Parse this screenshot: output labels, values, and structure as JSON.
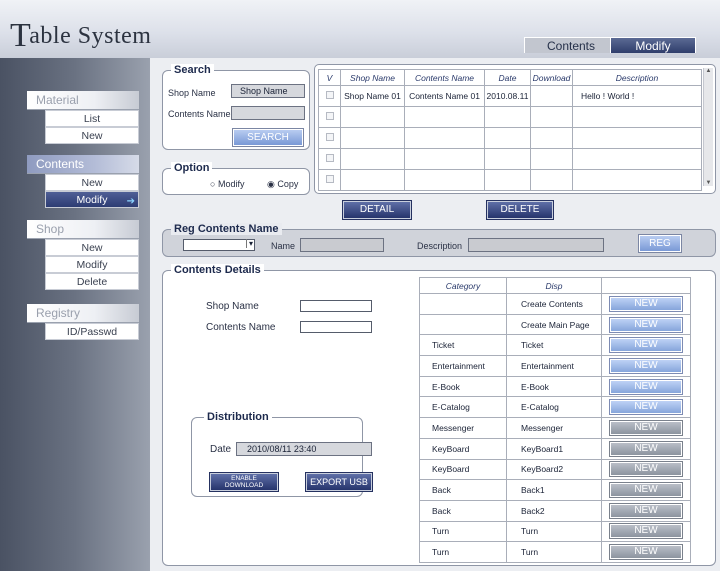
{
  "app": {
    "title_cap": "T",
    "title_rest": "able System"
  },
  "top_tabs": [
    {
      "label": "Contents",
      "active": false
    },
    {
      "label": "Modify",
      "active": true
    }
  ],
  "sidebar": {
    "groups": [
      {
        "title": "Material",
        "items": [
          "List",
          "New"
        ]
      },
      {
        "title": "Contents",
        "items": [
          "New",
          "Modify"
        ]
      },
      {
        "title": "Shop",
        "items": [
          "New",
          "Modify",
          "Delete"
        ]
      },
      {
        "title": "Registry",
        "items": [
          "ID/Passwd"
        ]
      }
    ]
  },
  "search": {
    "title": "Search",
    "shop_label": "Shop Name",
    "shop_value": "Shop Name",
    "contents_label": "Contents Name",
    "contents_value": "",
    "button": "SEARCH"
  },
  "option": {
    "title": "Option",
    "modify": "Modify",
    "copy": "Copy",
    "selected": "Copy"
  },
  "results": {
    "headers": [
      "V",
      "Shop Name",
      "Contents Name",
      "Date",
      "Download",
      "Description"
    ],
    "rows": [
      {
        "shop": "Shop Name 01",
        "contents": "Contents Name 01",
        "date": "2010.08.11",
        "download": "",
        "desc": "Hello !   World !"
      },
      {
        "shop": "",
        "contents": "",
        "date": "",
        "download": "",
        "desc": ""
      },
      {
        "shop": "",
        "contents": "",
        "date": "",
        "download": "",
        "desc": ""
      },
      {
        "shop": "",
        "contents": "",
        "date": "",
        "download": "",
        "desc": ""
      },
      {
        "shop": "",
        "contents": "",
        "date": "",
        "download": "",
        "desc": ""
      }
    ],
    "detail_button": "DETAIL",
    "delete_button": "DELETE"
  },
  "reg": {
    "title": "Reg Contents Name",
    "name_label": "Name",
    "desc_label": "Description",
    "button": "REG"
  },
  "details": {
    "title": "Contents Details",
    "shop_label": "Shop Name",
    "contents_label": "Contents Name"
  },
  "distribution": {
    "title": "Distribution",
    "date_label": "Date",
    "date_value": "2010/08/11 23:40",
    "enable_line1": "ENABLE",
    "enable_line2": "DOWNLOAD",
    "export": "EXPORT USB"
  },
  "category": {
    "headers": [
      "Category",
      "Disp"
    ],
    "rows": [
      {
        "cat": "",
        "disp": "Create Contents",
        "btn": "NEW",
        "style": "blue"
      },
      {
        "cat": "",
        "disp": "Create Main Page",
        "btn": "NEW",
        "style": "blue"
      },
      {
        "cat": "Ticket",
        "disp": "Ticket",
        "btn": "NEW",
        "style": "blue"
      },
      {
        "cat": "Entertainment",
        "disp": "Entertainment",
        "btn": "NEW",
        "style": "blue"
      },
      {
        "cat": "E-Book",
        "disp": "E-Book",
        "btn": "NEW",
        "style": "blue"
      },
      {
        "cat": "E-Catalog",
        "disp": "E-Catalog",
        "btn": "NEW",
        "style": "blue"
      },
      {
        "cat": "Messenger",
        "disp": "Messenger",
        "btn": "NEW",
        "style": "gray"
      },
      {
        "cat": "KeyBoard",
        "disp": "KeyBoard1",
        "btn": "NEW",
        "style": "gray"
      },
      {
        "cat": "KeyBoard",
        "disp": "KeyBoard2",
        "btn": "NEW",
        "style": "gray"
      },
      {
        "cat": "Back",
        "disp": "Back1",
        "btn": "NEW",
        "style": "gray"
      },
      {
        "cat": "Back",
        "disp": "Back2",
        "btn": "NEW",
        "style": "gray"
      },
      {
        "cat": "Turn",
        "disp": "Turn",
        "btn": "NEW",
        "style": "gray"
      },
      {
        "cat": "Turn",
        "disp": "Turn",
        "btn": "NEW",
        "style": "gray"
      }
    ]
  }
}
